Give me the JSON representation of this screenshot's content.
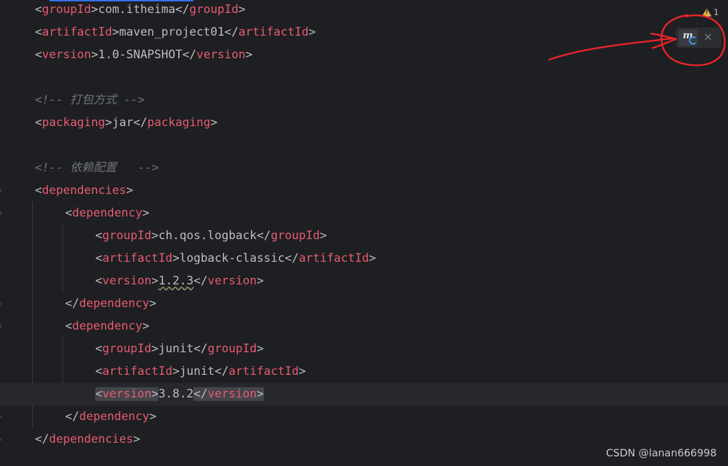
{
  "editor": {
    "lines": {
      "groupid_top": {
        "open_tag": "groupId",
        "text": "com.itheima",
        "close_tag": "groupId"
      },
      "artifactid_top": {
        "open_tag": "artifactId",
        "text": "maven_project01",
        "close_tag": "artifactId"
      },
      "version_top": {
        "open_tag": "version",
        "text": "1.0-SNAPSHOT",
        "close_tag": "version"
      },
      "comment_packaging": "<!-- 打包方式 -->",
      "packaging": {
        "open_tag": "packaging",
        "text": "jar",
        "close_tag": "packaging"
      },
      "comment_dependencies": "<!-- 依赖配置   -->",
      "dependencies_open": "dependencies",
      "dep1": {
        "open": "dependency",
        "groupid": {
          "open_tag": "groupId",
          "text": "ch.qos.logback",
          "close_tag": "groupId"
        },
        "artifactid": {
          "open_tag": "artifactId",
          "text": "logback-classic",
          "close_tag": "artifactId"
        },
        "version": {
          "open_tag": "version",
          "text": "1.2.3",
          "close_tag": "version"
        },
        "close": "dependency"
      },
      "dep2": {
        "open": "dependency",
        "groupid": {
          "open_tag": "groupId",
          "text": "junit",
          "close_tag": "groupId"
        },
        "artifactid": {
          "open_tag": "artifactId",
          "text": "junit",
          "close_tag": "artifactId"
        },
        "version": {
          "open_tag": "version",
          "text": "3.8.2",
          "close_tag": "version"
        },
        "close": "dependency"
      },
      "dependencies_close": "dependencies"
    }
  },
  "inspection": {
    "warning_count": "1",
    "icon": "warning-triangle-icon"
  },
  "maven_reload": {
    "icon": "maven-reload-icon",
    "close_icon": "close-icon",
    "close_glyph": "×"
  },
  "annotation": {
    "color": "#e8242a"
  },
  "watermark": "CSDN @lanan666998",
  "colors": {
    "background": "#1e1f22",
    "tag": "#e75c71",
    "text": "#bcbec4",
    "comment": "#6f737a",
    "accent": "#3574f0"
  }
}
